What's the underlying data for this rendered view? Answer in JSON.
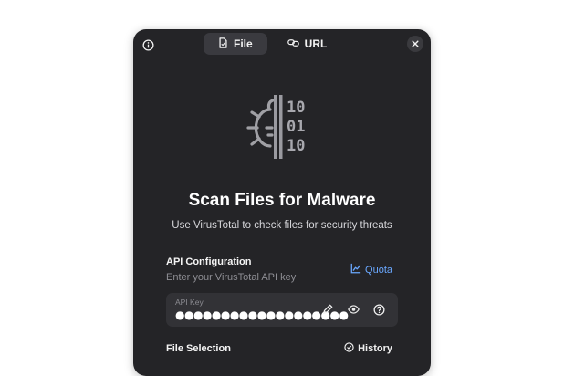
{
  "header": {
    "tabs": [
      {
        "label": "File",
        "icon": "file-icon",
        "active": true
      },
      {
        "label": "URL",
        "icon": "link-icon",
        "active": false
      }
    ],
    "info_icon": "info-icon",
    "close_icon": "close-icon"
  },
  "hero": {
    "icon": "bug-binary-icon",
    "title": "Scan Files for Malware",
    "subtitle": "Use VirusTotal to check files for security threats",
    "binary_rows": [
      "10",
      "01",
      "10"
    ]
  },
  "api": {
    "title": "API Configuration",
    "description": "Enter your VirusTotal API key",
    "quota_label": "Quota",
    "key_label": "API Key",
    "key_value": "●●●●●●●●●●●●●●●●●●●"
  },
  "file_selection": {
    "title": "File Selection",
    "history_label": "History"
  },
  "colors": {
    "panel_bg": "#242427",
    "accent_link": "#6aa8ff",
    "field_bg": "#323236"
  }
}
